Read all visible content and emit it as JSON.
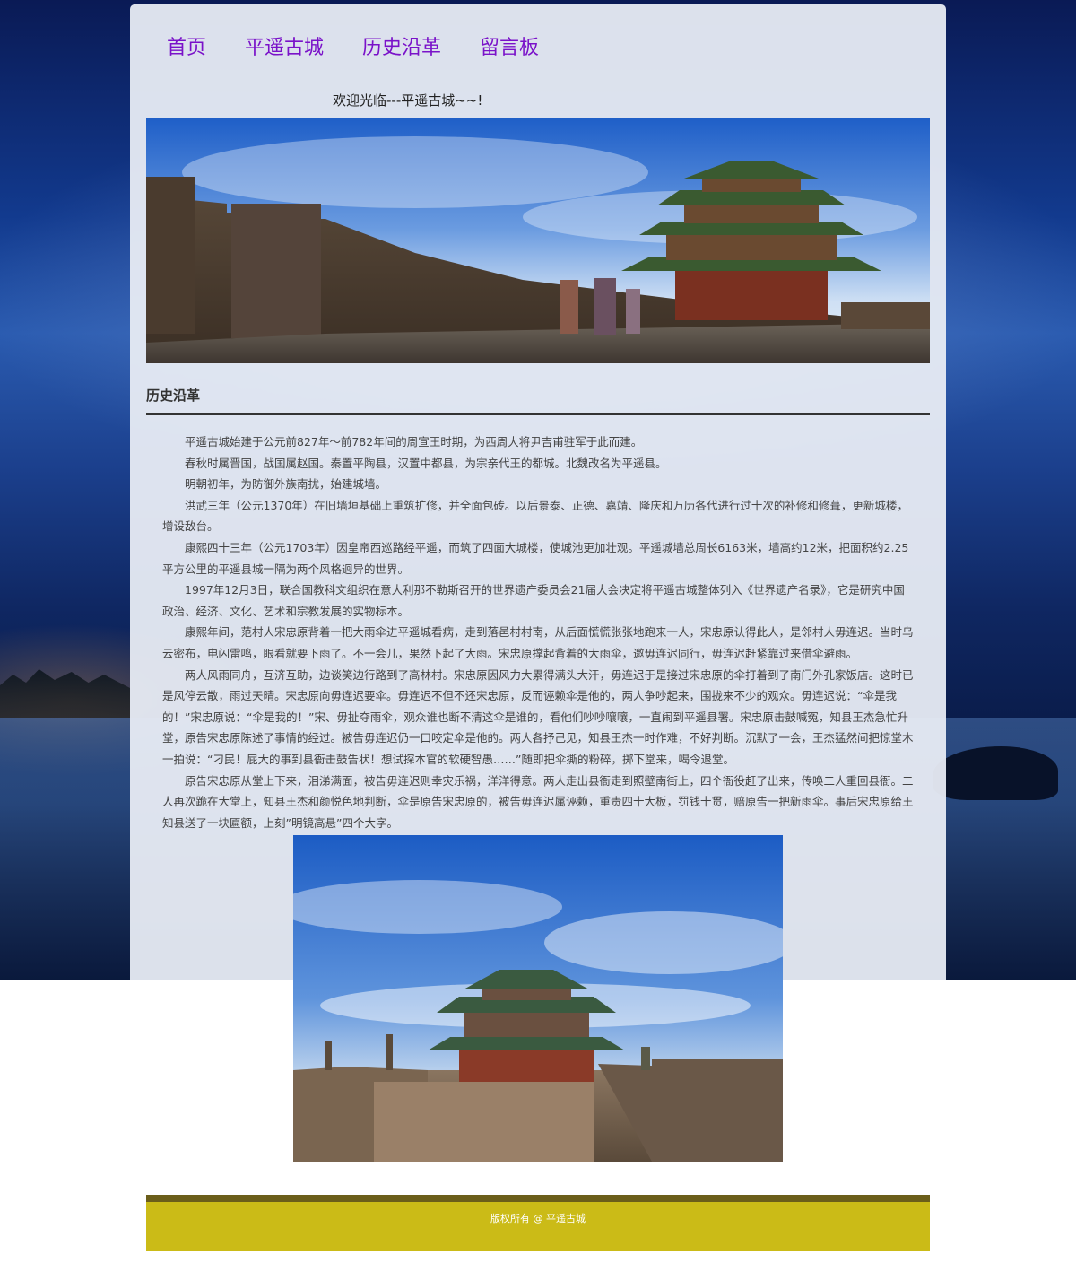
{
  "nav": {
    "items": [
      {
        "label": "首页"
      },
      {
        "label": "平遥古城"
      },
      {
        "label": "历史沿革"
      },
      {
        "label": "留言板"
      }
    ]
  },
  "welcome": "欢迎光临---平遥古城~~!",
  "banner": {
    "description_icon": "city-wall-tower-image"
  },
  "section": {
    "title": "历史沿革"
  },
  "article": {
    "paragraphs": [
      "平遥古城始建于公元前827年～前782年间的周宣王时期，为西周大将尹吉甫驻军于此而建。",
      "春秋时属晋国，战国属赵国。秦置平陶县，汉置中都县，为宗亲代王的都城。北魏改名为平遥县。",
      "明朝初年，为防御外族南扰，始建城墙。",
      "洪武三年（公元1370年）在旧墙垣基础上重筑扩修，并全面包砖。以后景泰、正德、嘉靖、隆庆和万历各代进行过十次的补修和修葺，更新城楼，增设敌台。",
      "康熙四十三年（公元1703年）因皇帝西巡路经平遥，而筑了四面大城楼，使城池更加壮观。平遥城墙总周长6163米，墙高约12米，把面积约2.25平方公里的平遥县城一隔为两个风格迥异的世界。",
      "1997年12月3日，联合国教科文组织在意大利那不勒斯召开的世界遗产委员会21届大会决定将平遥古城整体列入《世界遗产名录》，它是研究中国政治、经济、文化、艺术和宗教发展的实物标本。",
      "康熙年间，范村人宋忠原背着一把大雨伞进平遥城看病，走到落邑村村南，从后面慌慌张张地跑来一人，宋忠原认得此人，是邻村人毋连迟。当时乌云密布，电闪雷鸣，眼看就要下雨了。不一会儿，果然下起了大雨。宋忠原撑起背着的大雨伞，邀毋连迟同行，毋连迟赶紧靠过来借伞避雨。",
      "两人风雨同舟，互济互助，边谈笑边行路到了高林村。宋忠原因风力大累得满头大汗，毋连迟于是接过宋忠原的伞打着到了南门外孔家饭店。这时已是风停云散，雨过天晴。宋忠原向毋连迟要伞。毋连迟不但不还宋忠原，反而诬赖伞是他的，两人争吵起来，围拢来不少的观众。毋连迟说：“伞是我的！”宋忠原说：“伞是我的！”宋、毋扯夺雨伞，观众谁也断不清这伞是谁的，看他们吵吵嚷嚷，一直闹到平遥县署。宋忠原击鼓喊冤，知县王杰急忙升堂，原告宋忠原陈述了事情的经过。被告毋连迟仍一口咬定伞是他的。两人各抒己见，知县王杰一时作难，不好判断。沉默了一会，王杰猛然间把惊堂木一拍说：“刁民！屁大的事到县衙击鼓告状！想试探本官的软硬智愚……”随即把伞撕的粉碎，掷下堂来，喝令退堂。",
      "原告宋忠原从堂上下来，泪涕满面，被告毋连迟则幸灾乐祸，洋洋得意。两人走出县衙走到照壁南街上，四个衙役赶了出来，传唤二人重回县衙。二人再次跪在大堂上，知县王杰和颜悦色地判断，伞是原告宋忠原的，被告毋连迟属诬赖，重责四十大板，罚钱十贯，赔原告一把新雨伞。事后宋忠原给王知县送了一块匾额，上刻”明镜高悬”四个大字。"
    ]
  },
  "photo": {
    "description_icon": "city-gate-tower-image"
  },
  "footer": {
    "text": "版权所有 @ 平遥古城"
  },
  "colors": {
    "nav_text": "#7a12c9",
    "panel_bg": "#e8ecf4",
    "footer_bg": "#cbbb17",
    "footer_bar": "#6b5e1a"
  }
}
